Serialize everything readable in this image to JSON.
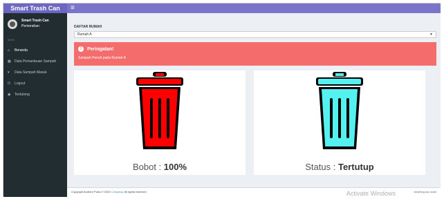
{
  "topbar": {
    "brand": "Smart Trash Can",
    "menu_toggle": "≡"
  },
  "sidebar": {
    "user_line1": "Smart Trash Can",
    "user_line2": "Pemerahan",
    "section_label": "MAIN",
    "items": [
      {
        "icon": "home-icon",
        "glyph": "⌂",
        "label": "Beranda",
        "active": true
      },
      {
        "icon": "table-icon",
        "glyph": "▦",
        "label": "Data Pemantauan Sampah",
        "active": false
      },
      {
        "icon": "trash-icon",
        "glyph": "▾",
        "label": "Data Sampah Masuk",
        "active": false
      },
      {
        "icon": "logout-icon",
        "glyph": "⏻",
        "label": "Logout",
        "active": false
      },
      {
        "icon": "info-icon",
        "glyph": "◉",
        "label": "Tentutong",
        "active": false
      }
    ]
  },
  "main": {
    "field_label": "DAFTAR RUMAH",
    "select_value": "Rumah A",
    "alert": {
      "title": "Peringatan!",
      "message": "Sampah Penuh pada Rumah A",
      "color": "#f56c6c"
    },
    "cards": [
      {
        "color": "#ff0000",
        "label": "Bobot : ",
        "value": "100%"
      },
      {
        "color": "#55f0f0",
        "label": "Status : ",
        "value": "Tertutup"
      }
    ]
  },
  "footer": {
    "left_prefix": "Copyright Andhen Putra © 2020 ",
    "left_link": "Company",
    "left_suffix": ". All rights reserved.",
    "watermark": "Activate Windows",
    "right": "Anything you want"
  }
}
